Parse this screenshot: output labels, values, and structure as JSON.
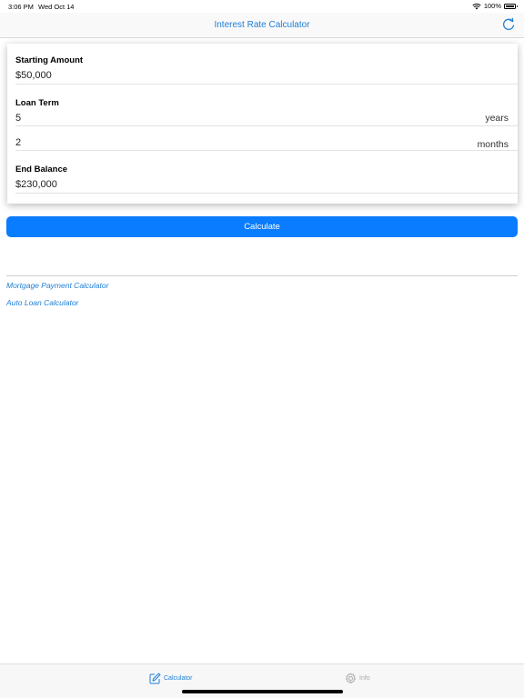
{
  "status": {
    "time": "3:06 PM",
    "date": "Wed Oct 14",
    "battery": "100%"
  },
  "nav": {
    "title": "Interest Rate Calculator"
  },
  "form": {
    "starting_amount": {
      "label": "Starting Amount",
      "currency": "$",
      "value": "50,000"
    },
    "loan_term": {
      "label": "Loan Term",
      "years_value": "5",
      "years_unit": "years",
      "months_value": "2",
      "months_unit": "months"
    },
    "end_balance": {
      "label": "End Balance",
      "currency": "$",
      "value": "230,000"
    }
  },
  "actions": {
    "calculate_label": "Calculate"
  },
  "links": [
    {
      "label": "Mortgage Payment Calculator"
    },
    {
      "label": "Auto Loan Calculator"
    }
  ],
  "tabs": [
    {
      "label": "Calculator",
      "icon": "pencil-square-icon",
      "active": true
    },
    {
      "label": "Info",
      "icon": "gear-icon",
      "active": false
    }
  ],
  "colors": {
    "accent": "#1e7fd6",
    "button": "#0a7cff",
    "inactive": "#a8a8a8"
  }
}
